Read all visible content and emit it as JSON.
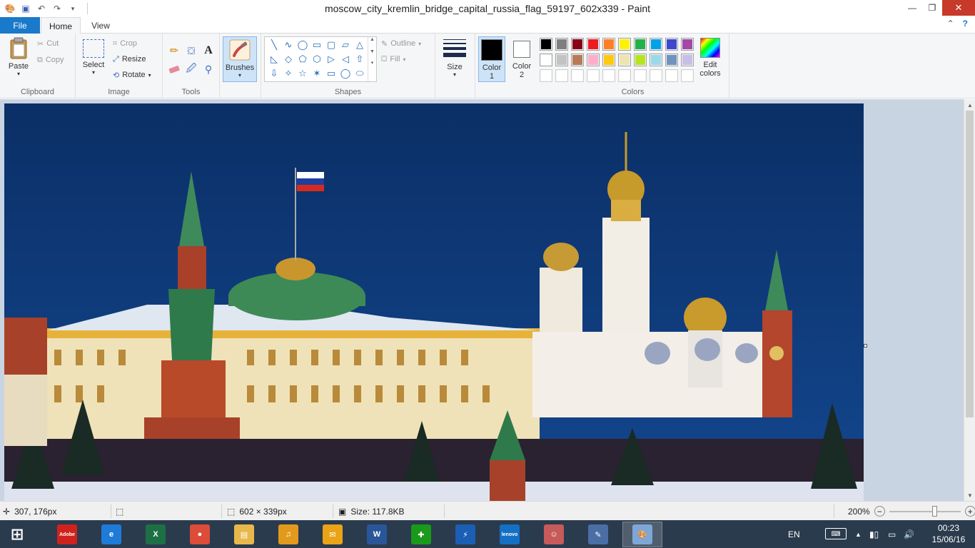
{
  "window": {
    "title": "moscow_city_kremlin_bridge_capital_russia_flag_59197_602x339 - Paint",
    "minimize": "—",
    "restore": "❐",
    "close": "✕"
  },
  "quick_access": {
    "app_icon": "paint-palette-icon",
    "items": [
      {
        "name": "save-icon",
        "glyph": "💾"
      },
      {
        "name": "undo-icon",
        "glyph": "↶"
      },
      {
        "name": "redo-icon",
        "glyph": "↷"
      },
      {
        "name": "customize-icon",
        "glyph": "▾"
      }
    ]
  },
  "tabs": {
    "file": "File",
    "home": "Home",
    "view": "View",
    "collapse_glyph": "⌃",
    "help_glyph": "?"
  },
  "ribbon": {
    "clipboard": {
      "label": "Clipboard",
      "paste": "Paste",
      "cut": "Cut",
      "copy": "Copy"
    },
    "image": {
      "label": "Image",
      "select": "Select",
      "crop": "Crop",
      "resize": "Resize",
      "rotate": "Rotate"
    },
    "tools": {
      "label": "Tools",
      "items": [
        "pencil-icon",
        "fill-bucket-icon",
        "text-icon",
        "eraser-icon",
        "color-picker-icon",
        "magnifier-icon"
      ]
    },
    "brushes": {
      "label": "Brushes"
    },
    "shapes": {
      "label": "Shapes",
      "outline": "Outline",
      "fill": "Fill",
      "glyphs": [
        "╲",
        "∿",
        "◯",
        "▭",
        "▢",
        "▱",
        "△",
        "◺",
        "◇",
        "⬠",
        "⬡",
        "▷",
        "◁",
        "⇧",
        "⇩",
        "✧",
        "☆",
        "✶",
        "▭",
        "◯",
        "⬭"
      ]
    },
    "size": {
      "label": "Size"
    },
    "color1": {
      "label_line1": "Color",
      "label_line2": "1",
      "value": "#000000"
    },
    "color2": {
      "label_line1": "Color",
      "label_line2": "2",
      "value": "#ffffff"
    },
    "colors": {
      "label": "Colors",
      "row1": [
        "#000000",
        "#7f7f7f",
        "#880015",
        "#ed1c24",
        "#ff7f27",
        "#fff200",
        "#22b14c",
        "#00a2e8",
        "#3f48cc",
        "#a349a4"
      ],
      "row2": [
        "#ffffff",
        "#c3c3c3",
        "#b97a57",
        "#ffaec9",
        "#ffc90e",
        "#efe4b0",
        "#b5e61d",
        "#99d9ea",
        "#7092be",
        "#c8bfe7"
      ],
      "row3": [
        "#ffffff",
        "#ffffff",
        "#ffffff",
        "#ffffff",
        "#ffffff",
        "#ffffff",
        "#ffffff",
        "#ffffff",
        "#ffffff",
        "#ffffff"
      ]
    },
    "edit_colors": {
      "line1": "Edit",
      "line2": "colors"
    }
  },
  "status": {
    "cursor": "307, 176px",
    "dimensions": "602 × 339px",
    "size": "Size: 117.8KB",
    "zoom": "200%",
    "zoom_fraction": 0.64
  },
  "taskbar": {
    "apps": [
      {
        "name": "start-button",
        "label": "⊞",
        "color": "#2b3b4e"
      },
      {
        "name": "adobe-app",
        "label": "Adobe",
        "color": "#d0221c"
      },
      {
        "name": "internet-explorer-app",
        "label": "e",
        "color": "#1e7bd8"
      },
      {
        "name": "excel-app",
        "label": "X",
        "color": "#1d7044"
      },
      {
        "name": "chrome-app",
        "label": "●",
        "color": "#dd4b39"
      },
      {
        "name": "file-explorer-app",
        "label": "▤",
        "color": "#e8b84a"
      },
      {
        "name": "headphones-app",
        "label": "♫",
        "color": "#e39a1c"
      },
      {
        "name": "mail-app",
        "label": "✉",
        "color": "#e9a417"
      },
      {
        "name": "word-app",
        "label": "W",
        "color": "#2a5699"
      },
      {
        "name": "medical-cross-app",
        "label": "✚",
        "color": "#1a9a1a"
      },
      {
        "name": "security-shield-app",
        "label": "⚡",
        "color": "#1a5fb4"
      },
      {
        "name": "lenovo-app",
        "label": "lenovo",
        "color": "#1470c5"
      },
      {
        "name": "nurse-app",
        "label": "☺",
        "color": "#c85a5a"
      },
      {
        "name": "paint-editor-app",
        "label": "✎",
        "color": "#4a6fa5"
      },
      {
        "name": "paint-app",
        "label": "🎨",
        "color": "#7ea7d8"
      }
    ],
    "language": "EN",
    "time": "00:23",
    "date": "15/06/16"
  }
}
